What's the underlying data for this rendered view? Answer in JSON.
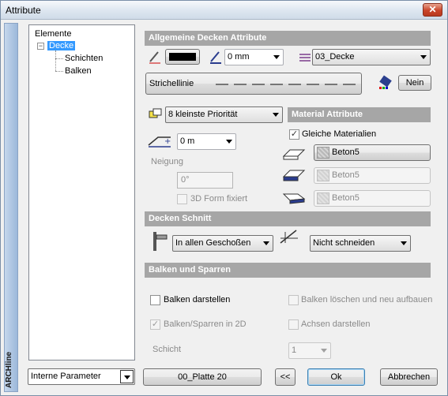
{
  "window": {
    "title": "Attribute",
    "close_glyph": "✕",
    "side_label": "ARCHline"
  },
  "tree": {
    "root": "Elemente",
    "expander": "−",
    "selected": "Decke",
    "children": [
      "Schichten",
      "Balken"
    ]
  },
  "general": {
    "header": "Allgemeine Decken Attribute",
    "line_width": "0 mm",
    "layer": "03_Decke",
    "line_style_label": "Strichellinie",
    "nein_button": "Nein"
  },
  "priority": {
    "value": "8 kleinste Priorität"
  },
  "offset": {
    "value": "0 m"
  },
  "neigung": {
    "label": "Neigung",
    "value": "0°",
    "form_fixed_label": "3D Form fixiert"
  },
  "material": {
    "header": "Material Attribute",
    "same_materials_label": "Gleiche Materialien",
    "same_materials_checked": true,
    "materials": [
      "Beton5",
      "Beton5",
      "Beton5"
    ]
  },
  "schnitt": {
    "header": "Decken Schnitt",
    "floors": "In allen Geschoßen",
    "cut": "Nicht schneiden"
  },
  "balken": {
    "header": "Balken und Sparren",
    "show_beams": "Balken darstellen",
    "beams_2d": "Balken/Sparren in 2D",
    "delete_recreate": "Balken löschen und neu aufbauen",
    "show_axes": "Achsen darstellen",
    "layer_label": "Schicht",
    "layer_value": "1"
  },
  "footer": {
    "params": "Interne Parameter",
    "preset": "00_Platte 20",
    "back": "<<",
    "ok": "Ok",
    "cancel": "Abbrechen"
  },
  "colors": {
    "header_bg": "#a6a6a6",
    "selection": "#3399ff",
    "close_red": "#c9452a"
  }
}
